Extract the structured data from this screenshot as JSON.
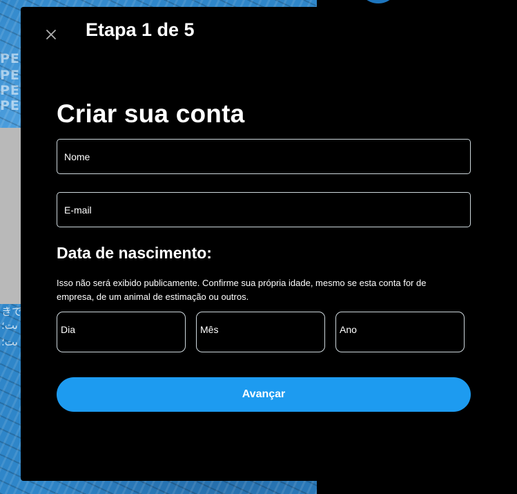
{
  "modal": {
    "close_icon": "close-icon",
    "step_title": "Etapa 1 de 5",
    "form_title": "Criar sua conta",
    "name_field": {
      "label": "Nome",
      "value": ""
    },
    "email_field": {
      "label": "E-mail",
      "value": ""
    },
    "dob": {
      "title": "Data de nascimento:",
      "description": "Isso não será exibido publicamente. Confirme sua própria idade, mesmo se esta conta for de empresa, de um animal de estimação ou outros.",
      "day_label": "Dia",
      "month_label": "Mês",
      "year_label": "Ano"
    },
    "next_button": "Avançar"
  },
  "colors": {
    "accent": "#1d9bf0",
    "modal_background": "#000000",
    "field_border": "#cfd9de"
  }
}
